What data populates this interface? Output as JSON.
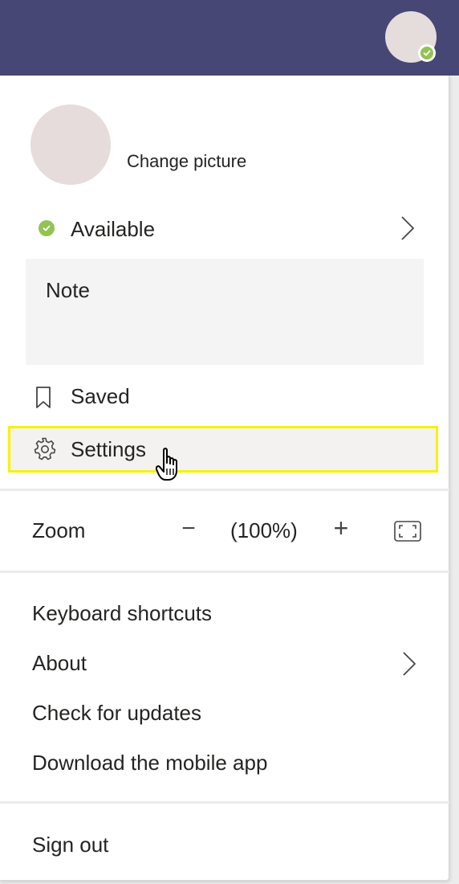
{
  "header": {
    "avatar_icon": "avatar",
    "presence_status": "available",
    "presence_color": "#92c353",
    "bar_color": "#464775"
  },
  "profile": {
    "change_picture_label": "Change picture",
    "status_label": "Available",
    "note_label": "Note"
  },
  "menu": {
    "saved_label": "Saved",
    "settings_label": "Settings",
    "highlight_color": "#f7f200",
    "zoom": {
      "label": "Zoom",
      "minus": "−",
      "level": "(100%)",
      "plus": "+",
      "fullscreen_icon": "fullscreen-icon"
    },
    "keyboard_shortcuts_label": "Keyboard shortcuts",
    "about_label": "About",
    "check_updates_label": "Check for updates",
    "download_mobile_label": "Download the mobile app",
    "sign_out_label": "Sign out"
  }
}
